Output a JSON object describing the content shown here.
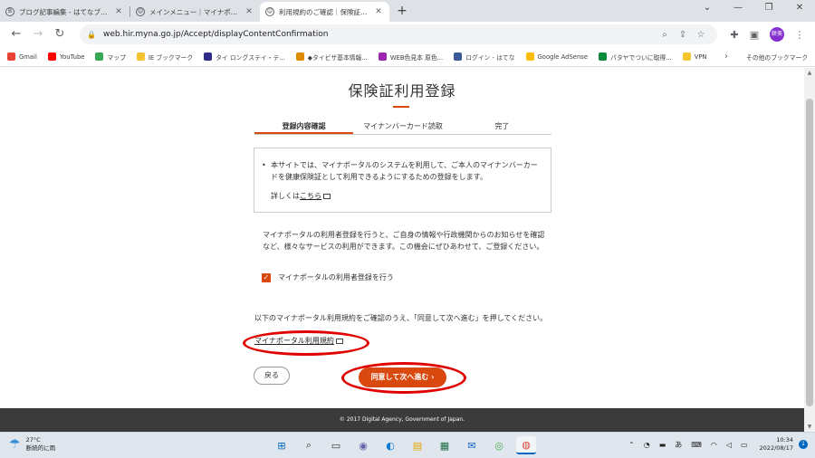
{
  "browser": {
    "tabs": [
      {
        "icon": "blog-icon",
        "title": "ブログ記事編集 - はてなブログ",
        "active": false
      },
      {
        "icon": "myna-icon",
        "title": "メインメニュー｜マイナポータル",
        "active": false
      },
      {
        "icon": "myna-icon",
        "title": "利用規約のご確認｜保険証利用登",
        "active": true
      }
    ],
    "new_tab": "+",
    "url": "web.hir.myna.go.jp/Accept/displayContentConfirmation",
    "profile_initials": "餅美",
    "bookmarks": [
      {
        "label": "Gmail",
        "color": "#ea4335"
      },
      {
        "label": "YouTube",
        "color": "#ff0000"
      },
      {
        "label": "マップ",
        "color": "#34a853"
      },
      {
        "label": "IE ブックマーク",
        "color": "#f4c430"
      },
      {
        "label": "タイ ロングステイ・テ...",
        "color": "#2d2a8a"
      },
      {
        "label": "◆タイビザ基本情報...",
        "color": "#e08a00"
      },
      {
        "label": "WEB色見本 原色...",
        "color": "#9c27b0"
      },
      {
        "label": "ログイン - はてな",
        "color": "#3b5998"
      },
      {
        "label": "Google AdSense",
        "color": "#fbbc05"
      },
      {
        "label": "パタヤでついに取得...",
        "color": "#0a8a3a"
      },
      {
        "label": "VPN",
        "color": "#f4c430"
      }
    ],
    "bookmarks_other": "その他のブックマーク"
  },
  "page": {
    "title": "保険証利用登録",
    "steps": [
      "登録内容確認",
      "マイナンバーカード読取",
      "完了"
    ],
    "notice_text": "本サイトでは、マイナポータルのシステムを利用して、ご本人のマイナンバーカードを健康保険証として利用できるようにするための登録をします。",
    "detail_prefix": "詳しくは",
    "detail_link": "こちら",
    "description": "マイナポータルの利用者登録を行うと、ご自身の情報や行政機関からのお知らせを確認など、様々なサービスの利用ができます。この機会にぜひあわせて、ご登録ください。",
    "checkbox_label": "マイナポータルの利用者登録を行う",
    "checkbox_checked": true,
    "terms_text": "以下のマイナポータル利用規約をご確認のうえ、「同意して次へ進む」を押してください。",
    "terms_link": "マイナポータル利用規約",
    "back_button": "戻る",
    "agree_button": "同意して次へ進む",
    "footer": "© 2017 Digital Agency, Government of Japan."
  },
  "taskbar": {
    "weather_temp": "27°C",
    "weather_desc": "断続的に雨",
    "ime": "あ",
    "time": "10:34",
    "date": "2022/08/17",
    "notifications": "1"
  },
  "colors": {
    "accent": "#d9480f",
    "annotation": "#e00000",
    "footer_bg": "#3b3b3b"
  }
}
